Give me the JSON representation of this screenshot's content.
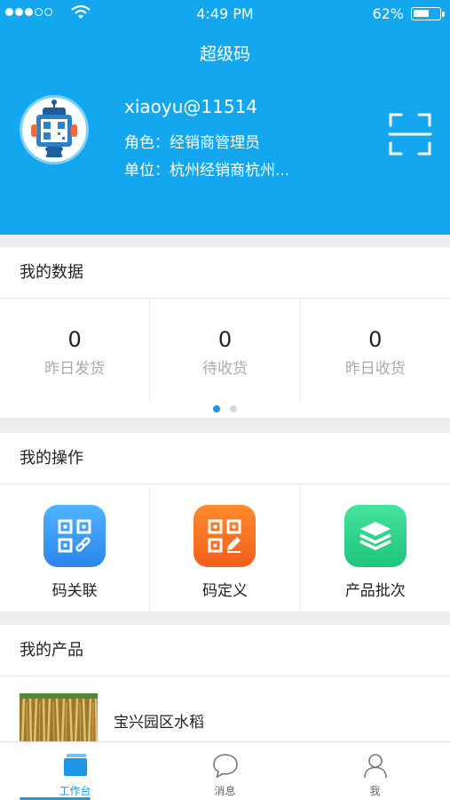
{
  "status_bar": {
    "time": "4:49 PM",
    "battery": "62%",
    "battery_level": 0.62
  },
  "header": {
    "title": "超级码",
    "username": "xiaoyu@11514",
    "role": "角色：经销商管理员",
    "unit": "单位：杭州经销商杭州..."
  },
  "my_data": {
    "title": "我的数据",
    "stats": [
      {
        "value": "0",
        "label": "昨日发货"
      },
      {
        "value": "0",
        "label": "待收货"
      },
      {
        "value": "0",
        "label": "昨日收货"
      }
    ],
    "page_indicator": {
      "current": 1,
      "total": 2
    }
  },
  "my_ops": {
    "title": "我的操作",
    "items": [
      {
        "label": "码关联",
        "icon": "qr-link-icon",
        "color": "#2f8ff0"
      },
      {
        "label": "码定义",
        "icon": "qr-edit-icon",
        "color": "#f26a1d"
      },
      {
        "label": "产品批次",
        "icon": "layers-icon",
        "color": "#2ed48a"
      }
    ]
  },
  "my_products": {
    "title": "我的产品",
    "items": [
      {
        "name": "宝兴园区水稻"
      }
    ]
  },
  "tabbar": {
    "tabs": [
      {
        "label": "工作台",
        "icon": "workbench-icon",
        "active": true
      },
      {
        "label": "消息",
        "icon": "message-icon",
        "active": false
      },
      {
        "label": "我",
        "icon": "user-icon",
        "active": false
      }
    ]
  },
  "colors": {
    "primary": "#12a7ef",
    "accent": "#1e96e4"
  }
}
